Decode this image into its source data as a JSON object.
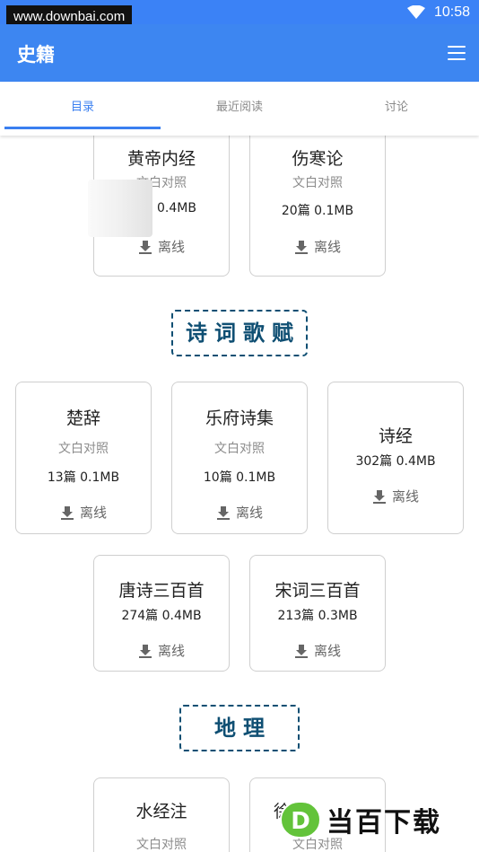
{
  "status_bar": {
    "watermark": "www.downbai.com",
    "time": "10:58",
    "bg_color": "#3b82f6"
  },
  "app_bar": {
    "title": "史籍",
    "menu_icon": "hamburger-menu-icon",
    "bg_color": "#3d86f1"
  },
  "tabs": [
    {
      "label": "目录",
      "active": true
    },
    {
      "label": "最近阅读",
      "active": false
    },
    {
      "label": "讨论",
      "active": false
    }
  ],
  "cards_top": [
    {
      "title": "黄帝内经",
      "subtitle": "文白对照",
      "stat": "0.4MB",
      "action": "离线"
    },
    {
      "title": "伤寒论",
      "subtitle": "文白对照",
      "stat": "20篇 0.1MB",
      "action": "离线"
    }
  ],
  "section_poetry": {
    "title": "诗词歌赋"
  },
  "cards_poetry": [
    {
      "title": "楚辞",
      "subtitle": "文白对照",
      "stat": "13篇 0.1MB",
      "action": "离线"
    },
    {
      "title": "乐府诗集",
      "subtitle": "文白对照",
      "stat": "10篇 0.1MB",
      "action": "离线"
    },
    {
      "title": "诗经",
      "stat": "302篇 0.4MB",
      "action": "离线"
    },
    {
      "title": "唐诗三百首",
      "stat": "274篇 0.4MB",
      "action": "离线"
    },
    {
      "title": "宋词三百首",
      "stat": "213篇 0.3MB",
      "action": "离线"
    }
  ],
  "section_geo": {
    "title": "地理"
  },
  "cards_geo": [
    {
      "title": "水经注",
      "subtitle": "文白对照"
    },
    {
      "title": "徐",
      "subtitle": "文白对照"
    }
  ],
  "watermark_logo": {
    "letter": "D",
    "text": "当百下载",
    "color": "#63c33a"
  },
  "accent_color": "#3a7ff0",
  "section_color": "#0f4f73"
}
